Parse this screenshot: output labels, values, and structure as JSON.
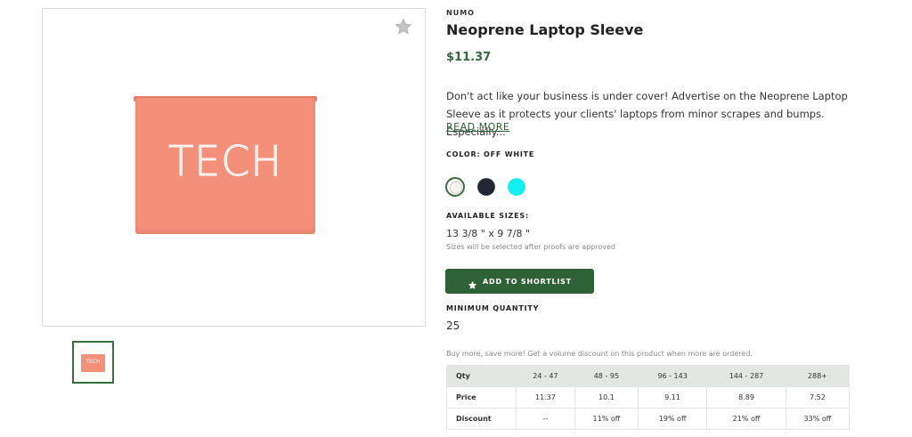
{
  "product": {
    "brand": "NUMO",
    "title": "Neoprene Laptop Sleeve",
    "price": "$11.37",
    "description": "Don't act like your business is under cover! Advertise on the Neoprene Laptop Sleeve as it protects your clients' laptops from minor scrapes and bumps. Especially...",
    "read_more": "READ MORE",
    "image_text": "TECH",
    "thumb_text": "TECH"
  },
  "colors": {
    "label": "COLOR: OFF WHITE",
    "swatches": [
      {
        "name": "off-white",
        "hex": "#f6f4ef",
        "selected": true
      },
      {
        "name": "navy",
        "hex": "#232634",
        "selected": false
      },
      {
        "name": "cyan",
        "hex": "#13eef0",
        "selected": false
      }
    ]
  },
  "sizes": {
    "label": "AVAILABLE SIZES:",
    "value": "13 3/8 \" x 9 7/8 \"",
    "note": "Sizes will be selected after proofs are approved"
  },
  "actions": {
    "shortlist_label": "ADD TO SHORTLIST"
  },
  "minimum": {
    "label": "MINIMUM QUANTITY",
    "value": "25"
  },
  "volume": {
    "note": "Buy more, save more! Get a volume discount on this product when more are ordered.",
    "header": [
      "Qty",
      "24 - 47",
      "48 - 95",
      "96 - 143",
      "144 - 287",
      "288+"
    ],
    "price": [
      "Price",
      "11.37",
      "10.1",
      "9.11",
      "8.89",
      "7.52"
    ],
    "discount": [
      "Discount",
      "--",
      "11% off",
      "19% off",
      "21% off",
      "33% off"
    ]
  },
  "theme": {
    "accent": "#2f6136",
    "price_color": "#2f6b3a",
    "product_color": "#f4907a"
  }
}
